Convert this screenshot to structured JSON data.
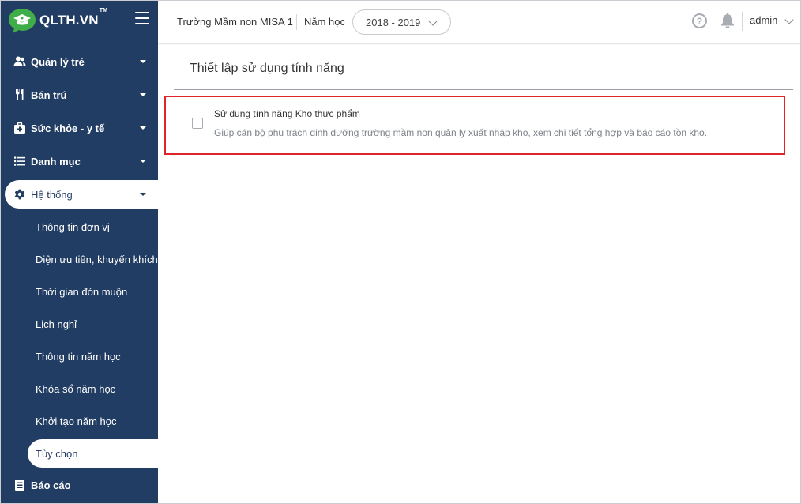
{
  "app": {
    "logo_text": "QLTH.VN",
    "logo_tm": "TM"
  },
  "sidebar": {
    "items": [
      {
        "label": "Quản lý trẻ",
        "icon": "users-icon"
      },
      {
        "label": "Bán trú",
        "icon": "utensils-icon"
      },
      {
        "label": "Sức khỏe - y tế",
        "icon": "medical-kit-icon"
      },
      {
        "label": "Danh mục",
        "icon": "list-icon"
      },
      {
        "label": "Hệ thống",
        "icon": "gear-icon"
      },
      {
        "label": "Báo cáo",
        "icon": "report-icon"
      }
    ],
    "submenu": [
      "Thông tin đơn vị",
      "Diện ưu tiên, khuyến khích",
      "Thời gian đón muộn",
      "Lịch nghỉ",
      "Thông tin năm học",
      "Khóa sổ năm học",
      "Khởi tạo năm học",
      "Tùy chọn"
    ]
  },
  "header": {
    "school": "Trường Mầm non MISA 1",
    "year_label": "Năm học",
    "year_value": "2018 - 2019",
    "help": "?",
    "user": "admin"
  },
  "main": {
    "title": "Thiết lập sử dụng tính năng",
    "feature": {
      "title": "Sử dụng tính năng Kho thực phẩm",
      "description": "Giúp cán bộ phụ trách dinh dưỡng trường mầm non quản lý xuất nhập kho, xem chi tiết tổng hợp và báo cáo tồn kho.",
      "checked": false
    }
  },
  "colors": {
    "sidebar_bg": "#223d63",
    "highlight_border": "#e0242a",
    "logo_green": "#3fae49"
  }
}
